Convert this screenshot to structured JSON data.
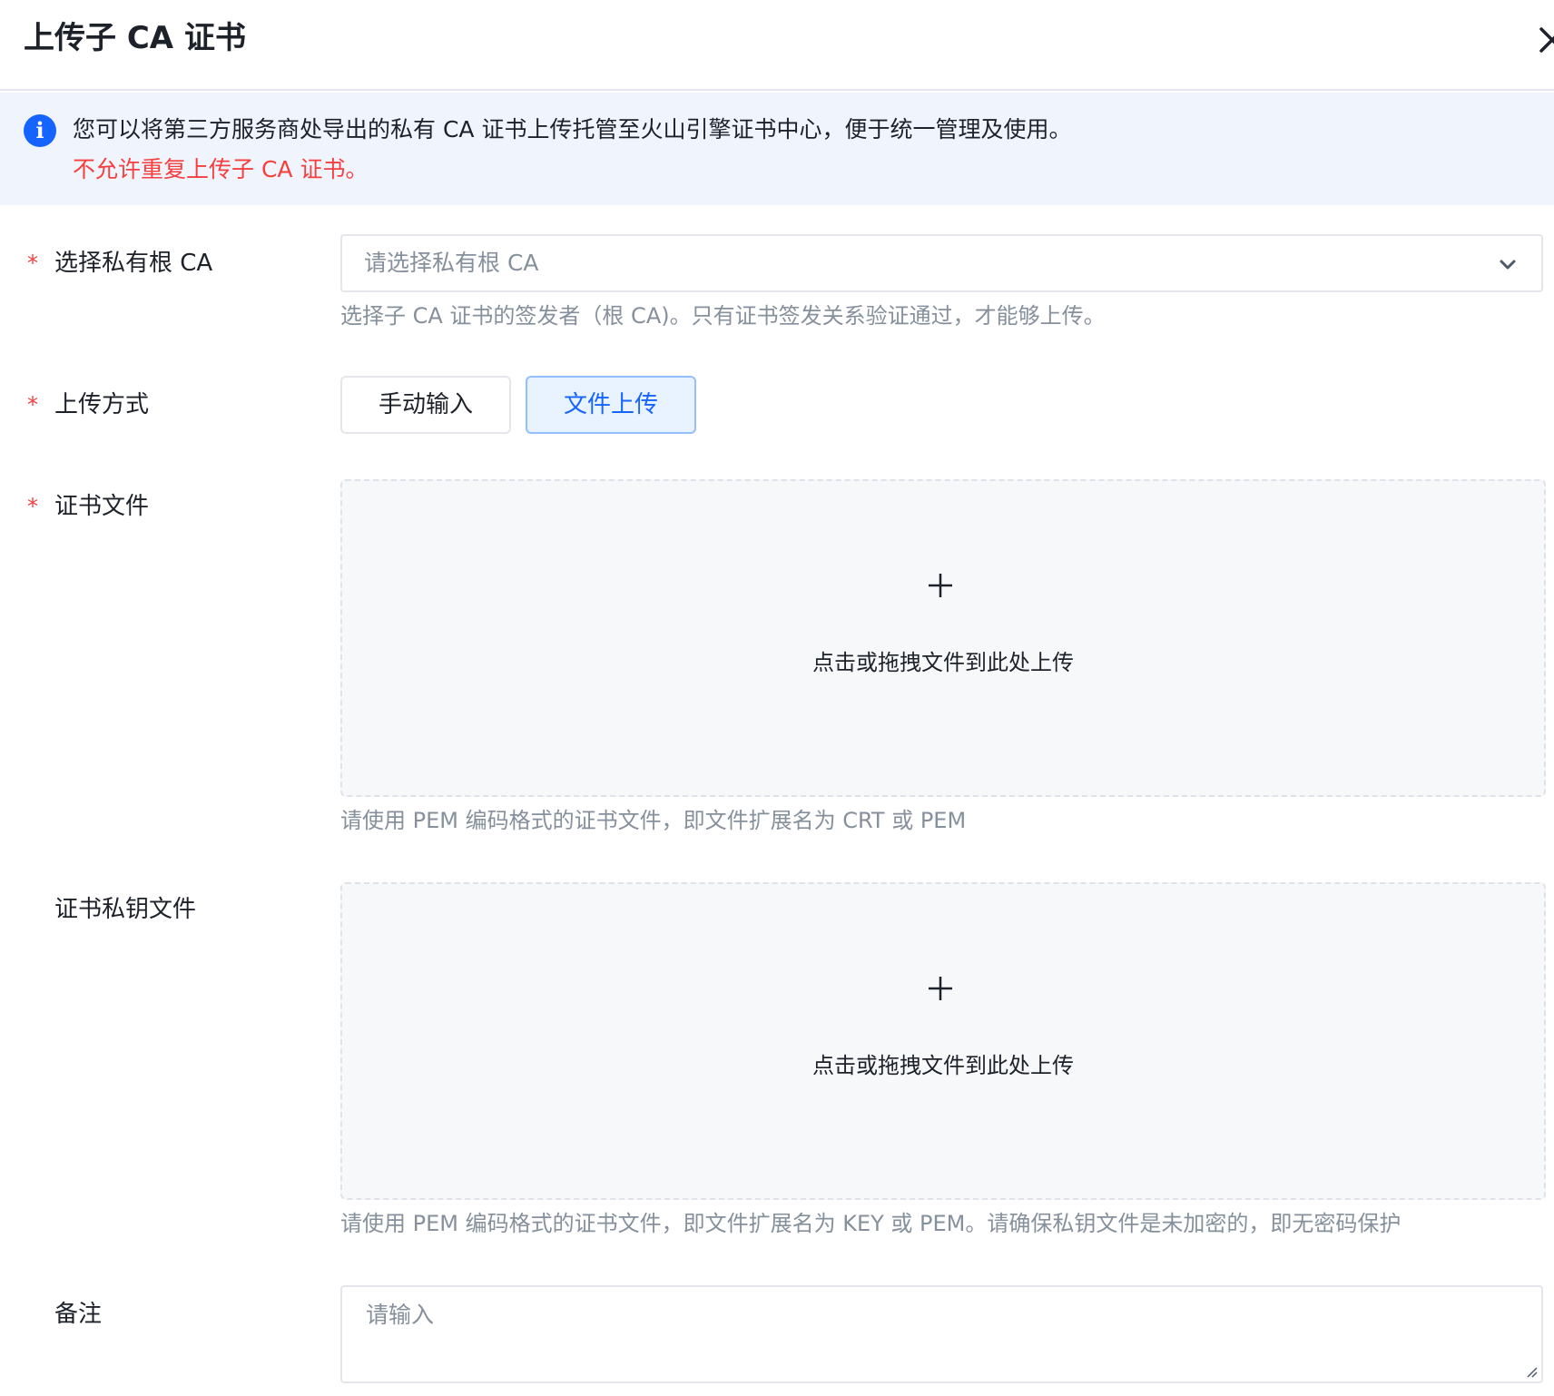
{
  "header": {
    "title": "上传子 CA 证书",
    "close_icon": "close-icon"
  },
  "alert": {
    "icon": "info-icon",
    "info_glyph": "i",
    "message": "您可以将第三方服务商处导出的私有 CA 证书上传托管至火山引擎证书中心，便于统一管理及使用。",
    "warning": "不允许重复上传子 CA 证书。"
  },
  "form": {
    "required_mark": "*",
    "root_ca": {
      "label": "选择私有根 CA",
      "placeholder": "请选择私有根 CA",
      "help": "选择子 CA 证书的签发者（根 CA)。只有证书签发关系验证通过，才能够上传。"
    },
    "upload_method": {
      "label": "上传方式",
      "options": [
        "手动输入",
        "文件上传"
      ],
      "selected": "文件上传"
    },
    "cert_file": {
      "label": "证书文件",
      "dropzone_text": "点击或拖拽文件到此处上传",
      "help": "请使用 PEM 编码格式的证书文件，即文件扩展名为 CRT 或 PEM"
    },
    "key_file": {
      "label": "证书私钥文件",
      "dropzone_text": "点击或拖拽文件到此处上传",
      "help": "请使用 PEM 编码格式的证书文件，即文件扩展名为 KEY 或 PEM。请确保私钥文件是未加密的，即无密码保护"
    },
    "remark": {
      "label": "备注",
      "placeholder": "请输入"
    }
  },
  "colors": {
    "primary": "#1664ff",
    "danger": "#f53f3f",
    "text": "#1d2129",
    "muted": "#86909c",
    "alert_bg": "#f0f4fd"
  }
}
